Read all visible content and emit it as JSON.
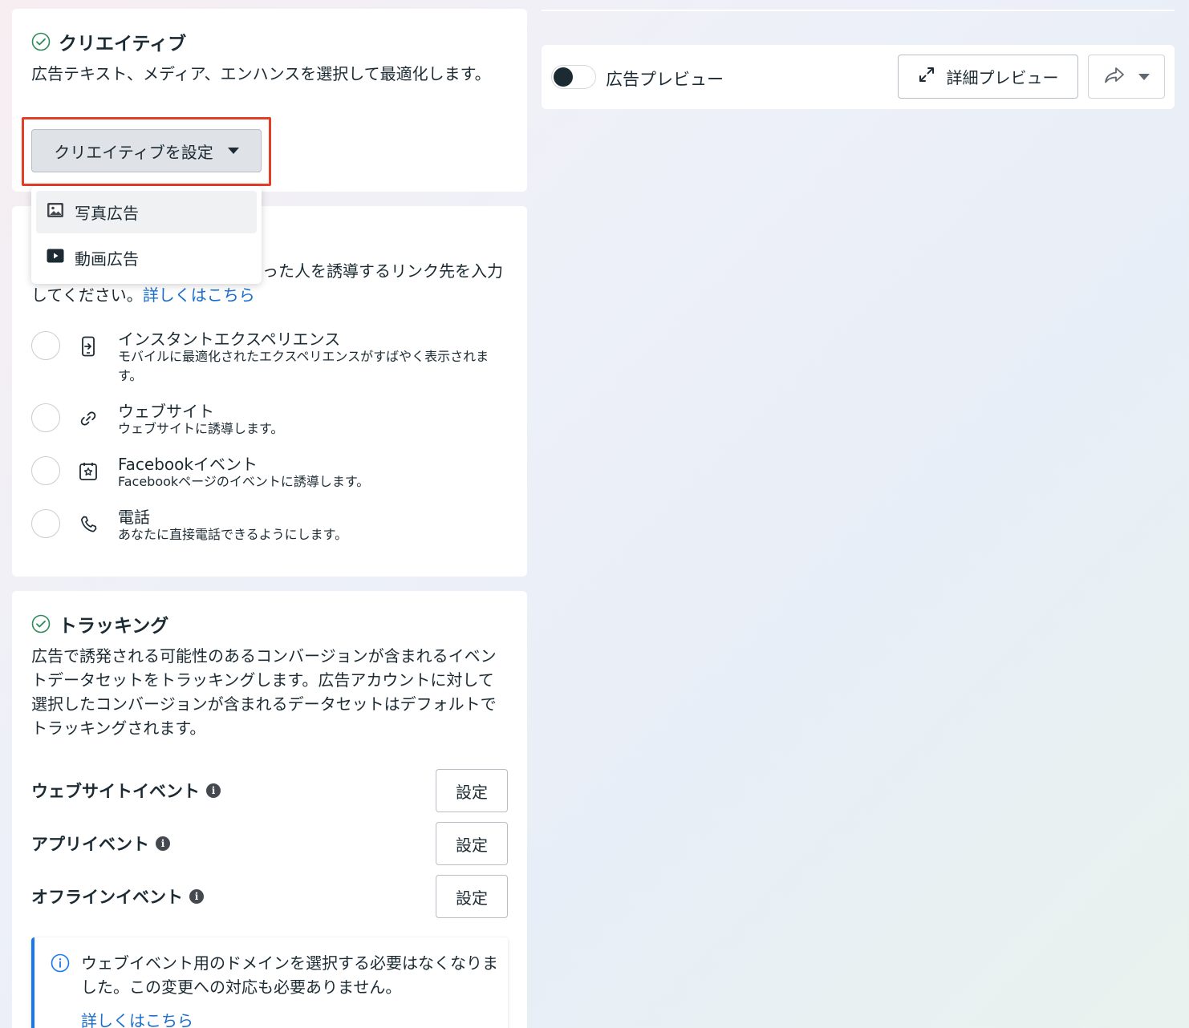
{
  "creative": {
    "title": "クリエイティブ",
    "description": "広告テキスト、メディア、エンハンスを選択して最適化します。",
    "button_label": "クリエイティブを設定",
    "dropdown": [
      {
        "label": "写真広告",
        "icon": "photo-icon"
      },
      {
        "label": "動画広告",
        "icon": "video-icon"
      }
    ]
  },
  "destination": {
    "description_visible": "った人を誘導するリンク先を入力",
    "description_line2": "してください。",
    "learn_more": "詳しくはこちら",
    "options": [
      {
        "title": "インスタントエクスペリエンス",
        "subtitle": "モバイルに最適化されたエクスペリエンスがすばやく表示されます。",
        "icon": "mobile-screen-icon"
      },
      {
        "title": "ウェブサイト",
        "subtitle": "ウェブサイトに誘導します。",
        "icon": "link-icon"
      },
      {
        "title": "Facebookイベント",
        "subtitle": "Facebookページのイベントに誘導します。",
        "icon": "event-star-icon"
      },
      {
        "title": "電話",
        "subtitle": "あなたに直接電話できるようにします。",
        "icon": "phone-icon"
      }
    ]
  },
  "tracking": {
    "title": "トラッキング",
    "description": "広告で誘発される可能性のあるコンバージョンが含まれるイベントデータセットをトラッキングします。広告アカウントに対して選択したコンバージョンが含まれるデータセットはデフォルトでトラッキングされます。",
    "rows": [
      {
        "label": "ウェブサイトイベント",
        "button": "設定"
      },
      {
        "label": "アプリイベント",
        "button": "設定"
      },
      {
        "label": "オフラインイベント",
        "button": "設定"
      }
    ],
    "info_glyph": "i",
    "notice": {
      "text": "ウェブイベント用のドメインを選択する必要はなくなりました。この変更への対応も必要ありません。",
      "link": "詳しくはこちら"
    }
  },
  "preview": {
    "toggle_label": "広告プレビュー",
    "detail_button": "詳細プレビュー"
  },
  "colors": {
    "highlight": "#e23e28",
    "link": "#1a6ecb",
    "notice_accent": "#1877f2",
    "check": "#31a24c"
  }
}
